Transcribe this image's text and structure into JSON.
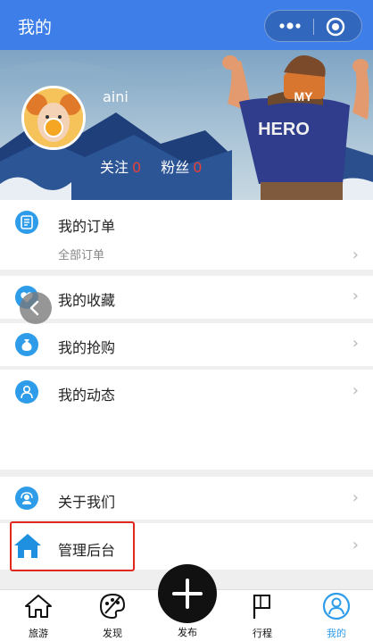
{
  "header": {
    "title": "我的"
  },
  "profile": {
    "username": "aini",
    "following_label": "关注",
    "following_count": "0",
    "fans_label": "粉丝",
    "fans_count": "0"
  },
  "banner": {
    "badge_text": "MY",
    "shirt_text": "HERO"
  },
  "menu": {
    "orders": {
      "label": "我的订单",
      "sub": "全部订单",
      "icon": "order-icon"
    },
    "favorites": {
      "label": "我的收藏",
      "icon": "heart-icon"
    },
    "flash": {
      "label": "我的抢购",
      "icon": "money-bag-icon"
    },
    "moments": {
      "label": "我的动态",
      "icon": "user-icon"
    },
    "about": {
      "label": "关于我们",
      "icon": "support-icon"
    },
    "admin": {
      "label": "管理后台",
      "icon": "home-icon"
    }
  },
  "chevron": "›",
  "tabs": {
    "travel": "旅游",
    "discover": "发现",
    "publish": "发布",
    "trip": "行程",
    "mine": "我的"
  },
  "colors": {
    "primary": "#3d7ee8",
    "accent": "#2e9ce9",
    "count": "#e8403a",
    "highlight": "#e0291c"
  }
}
